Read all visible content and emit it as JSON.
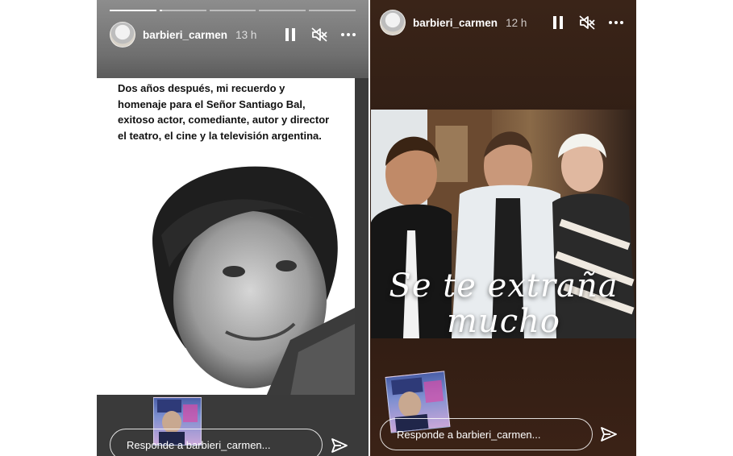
{
  "left_story": {
    "username": "barbieri_carmen",
    "time": "13 h",
    "progress": [
      1.0,
      0.05,
      0,
      0,
      0
    ],
    "caption": "Dos años después, mi recuerdo y homenaje para el Señor Santiago Bal, exitoso actor, comediante, autor y director el teatro, el cine y la televisión argentina.",
    "reply_placeholder": "Responde a barbieri_carmen..."
  },
  "right_story": {
    "username": "barbieri_carmen",
    "time": "12 h",
    "overlay_line1": "Se te extraña",
    "overlay_line2": "mucho",
    "reply_placeholder": "Responde a barbieri_carmen..."
  },
  "icons": {
    "pause": "pause-icon",
    "mute": "speaker-muted-icon",
    "more": "more-horizontal-icon",
    "send": "paper-plane-icon"
  }
}
